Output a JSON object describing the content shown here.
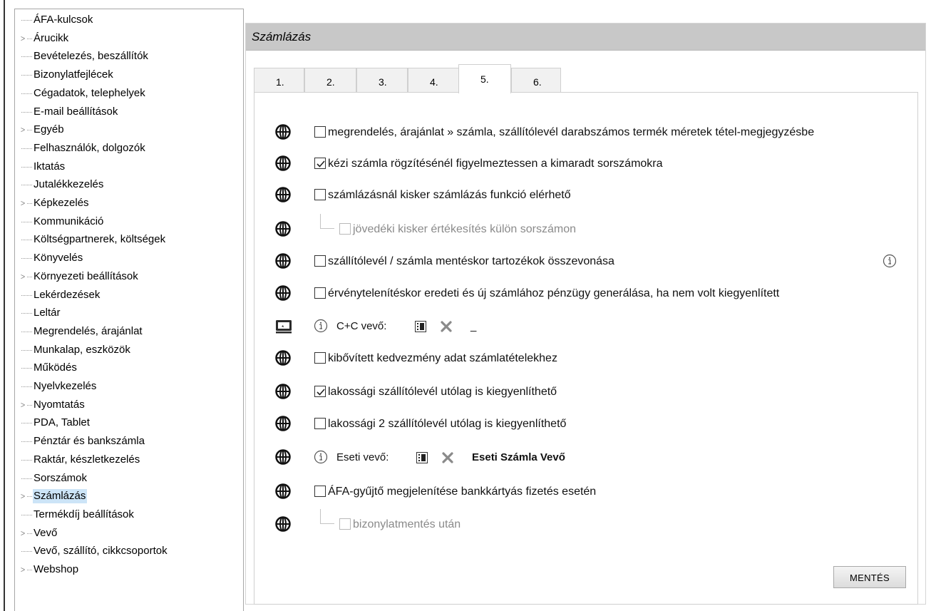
{
  "tree": {
    "items": [
      {
        "label": "ÁFA-kulcsok",
        "expandable": false
      },
      {
        "label": "Árucikk",
        "expandable": true
      },
      {
        "label": "Bevételezés, beszállítók",
        "expandable": false
      },
      {
        "label": "Bizonylatfejlécek",
        "expandable": false
      },
      {
        "label": "Cégadatok, telephelyek",
        "expandable": false
      },
      {
        "label": "E-mail beállítások",
        "expandable": false
      },
      {
        "label": "Egyéb",
        "expandable": true
      },
      {
        "label": "Felhasználók, dolgozók",
        "expandable": false
      },
      {
        "label": "Iktatás",
        "expandable": false
      },
      {
        "label": "Jutalékkezelés",
        "expandable": false
      },
      {
        "label": "Képkezelés",
        "expandable": true
      },
      {
        "label": "Kommunikáció",
        "expandable": false
      },
      {
        "label": "Költségpartnerek, költségek",
        "expandable": false
      },
      {
        "label": "Könyvelés",
        "expandable": false
      },
      {
        "label": "Környezeti beállítások",
        "expandable": true
      },
      {
        "label": "Lekérdezések",
        "expandable": false
      },
      {
        "label": "Leltár",
        "expandable": false
      },
      {
        "label": "Megrendelés, árajánlat",
        "expandable": false
      },
      {
        "label": "Munkalap, eszközök",
        "expandable": false
      },
      {
        "label": "Működés",
        "expandable": false
      },
      {
        "label": "Nyelvkezelés",
        "expandable": false
      },
      {
        "label": "Nyomtatás",
        "expandable": true
      },
      {
        "label": "PDA, Tablet",
        "expandable": false
      },
      {
        "label": "Pénztár és bankszámla",
        "expandable": false
      },
      {
        "label": "Raktár, készletkezelés",
        "expandable": false
      },
      {
        "label": "Sorszámok",
        "expandable": false
      },
      {
        "label": "Számlázás",
        "expandable": true,
        "selected": true
      },
      {
        "label": "Termékdíj beállítások",
        "expandable": false
      },
      {
        "label": "Vevő",
        "expandable": true
      },
      {
        "label": "Vevő, szállító, cikkcsoportok",
        "expandable": false
      },
      {
        "label": "Webshop",
        "expandable": true
      }
    ]
  },
  "header": {
    "title": "Számlázás"
  },
  "tabs": [
    {
      "label": "1."
    },
    {
      "label": "2."
    },
    {
      "label": "3."
    },
    {
      "label": "4."
    },
    {
      "label": "5.",
      "active": true
    },
    {
      "label": "6."
    }
  ],
  "settings": {
    "s1": {
      "label": "megrendelés, árajánlat » számla, szállítólevél darabszámos termék méretek tétel-megjegyzésbe",
      "checked": false
    },
    "s2": {
      "label": "kézi számla rögzítésénél figyelmeztessen a kimaradt sorszámokra",
      "checked": true
    },
    "s3": {
      "label": "számlázásnál kisker számlázás funkció elérhető",
      "checked": false
    },
    "s3a": {
      "label": "jövedéki kisker értékesítés külön sorszámon",
      "checked": false,
      "disabled": true
    },
    "s4": {
      "label": "szállítólevél / számla mentéskor tartozékok összevonása",
      "checked": false
    },
    "s5": {
      "label": "érvénytelenítéskor eredeti és új számlához pénzügy generálása, ha nem volt kiegyenlített",
      "checked": false
    },
    "cc": {
      "label": "C+C vevő:",
      "value": "_"
    },
    "s6": {
      "label": "kibővített kedvezmény adat számlatételekhez",
      "checked": false
    },
    "s7": {
      "label": "lakossági szállítólevél utólag is kiegyenlíthető",
      "checked": true
    },
    "s8": {
      "label": "lakossági 2 szállítólevél utólag is kiegyenlíthető",
      "checked": false
    },
    "eseti": {
      "label": "Eseti vevő:",
      "value": "Eseti Számla Vevő"
    },
    "s9": {
      "label": "ÁFA-gyűjtő megjelenítése bankkártyás fizetés esetén",
      "checked": false
    },
    "s9a": {
      "label": "bizonylatmentés után",
      "checked": false,
      "disabled": true
    }
  },
  "icons": {
    "globe": "globe-icon",
    "monitor": "monitor-icon",
    "info": "info-icon",
    "lookup": "list-lookup-icon",
    "clear": "clear-x-icon",
    "expander": "chevron-right-icon"
  },
  "buttons": {
    "save": "MENTÉS"
  },
  "colors": {
    "header_bg": "#c8c8c8",
    "selected_tree_bg": "#cce4f7",
    "tab_bg": "#f1f1f1"
  }
}
